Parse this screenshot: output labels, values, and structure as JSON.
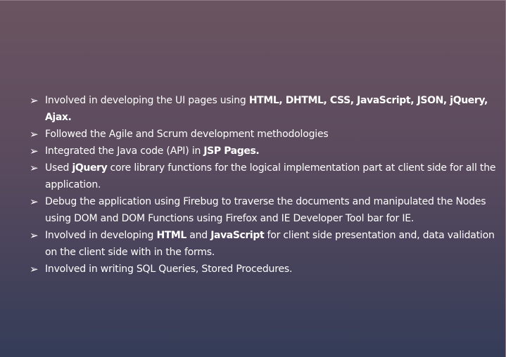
{
  "bullets": [
    {
      "icon": "arrow-bullet-icon",
      "parts": [
        {
          "text": "Involved in developing the UI pages using ",
          "bold": false
        },
        {
          "text": "HTML, DHTML, CSS, JavaScript, JSON, jQuery, Ajax.",
          "bold": true
        }
      ]
    },
    {
      "icon": "arrow-bullet-icon",
      "parts": [
        {
          "text": "Followed the Agile and Scrum development methodologies",
          "bold": false
        }
      ]
    },
    {
      "icon": "arrow-bullet-icon",
      "parts": [
        {
          "text": "Integrated the Java code (API) in ",
          "bold": false
        },
        {
          "text": "JSP Pages.",
          "bold": true
        }
      ]
    },
    {
      "icon": "arrow-bullet-icon",
      "parts": [
        {
          "text": "Used ",
          "bold": false
        },
        {
          "text": "jQuery",
          "bold": true
        },
        {
          "text": " core library functions for the logical implementation part at client side for all the application.",
          "bold": false
        }
      ]
    },
    {
      "icon": "arrow-bullet-icon",
      "parts": [
        {
          "text": "Debug the application using Firebug to traverse the documents and manipulated the Nodes using DOM and DOM Functions using Firefox and IE Developer Tool bar for IE.",
          "bold": false
        }
      ]
    },
    {
      "icon": "arrow-bullet-icon",
      "parts": [
        {
          "text": "Involved in developing ",
          "bold": false
        },
        {
          "text": "HTML",
          "bold": true
        },
        {
          "text": " and ",
          "bold": false
        },
        {
          "text": "JavaScript",
          "bold": true
        },
        {
          "text": " for client side presentation and, data validation on the client side with in the forms.",
          "bold": false
        }
      ]
    },
    {
      "icon": "arrow-bullet-icon",
      "parts": [
        {
          "text": "Involved in writing SQL Queries, Stored Procedures.",
          "bold": false
        }
      ]
    }
  ],
  "arrow_glyph": "➢"
}
